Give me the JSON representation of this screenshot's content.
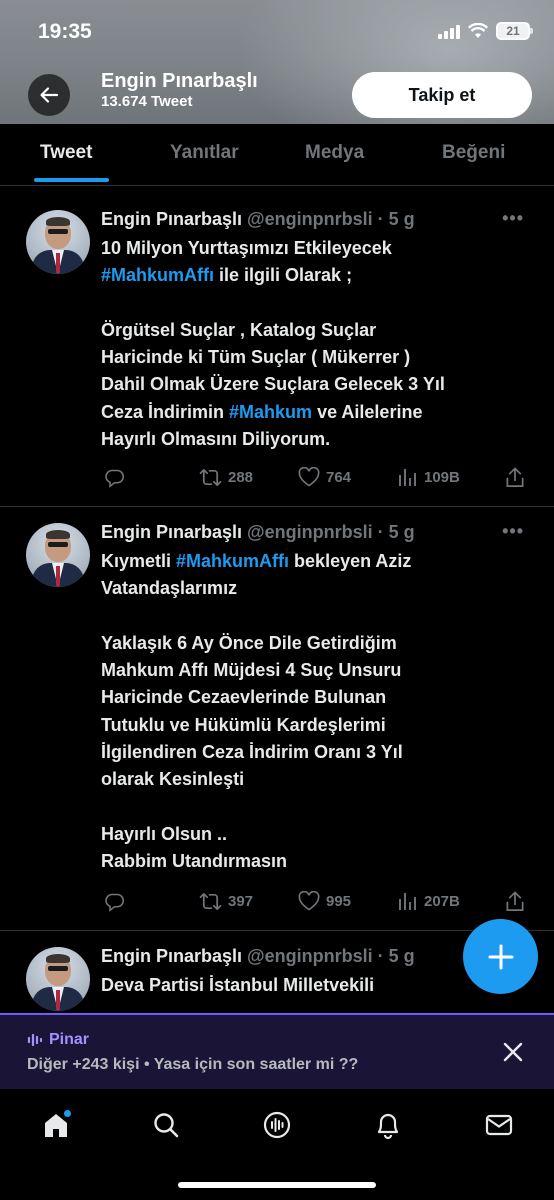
{
  "status_bar": {
    "time": "19:35",
    "battery": "21"
  },
  "header": {
    "name": "Engin Pınarbaşlı",
    "tweet_count": "13.674 Tweet",
    "follow_label": "Takip et"
  },
  "tabs": [
    {
      "label": "Tweet",
      "active": true
    },
    {
      "label": "Yanıtlar",
      "active": false
    },
    {
      "label": "Medya",
      "active": false
    },
    {
      "label": "Beğeni",
      "active": false
    }
  ],
  "tweets": [
    {
      "name": "Engin Pınarbaşlı",
      "handle_time": "@enginpnrbsli · 5 g",
      "body_lines": [
        {
          "parts": [
            "10 Milyon Yurttaşımızı Etkileyecek"
          ]
        },
        {
          "hashtag": "#MahkumAffı",
          "after": " ile ilgili Olarak ;"
        },
        {
          "blank": true
        },
        {
          "parts": [
            "Örgütsel Suçlar , Katalog Suçlar"
          ]
        },
        {
          "parts": [
            "Haricinde ki Tüm Suçlar ( Mükerrer )"
          ]
        },
        {
          "parts": [
            "Dahil Olmak Üzere Suçlara Gelecek  3 Yıl"
          ]
        },
        {
          "before": "Ceza İndirimin ",
          "hashtag": "#Mahkum",
          "after": " ve Ailelerine"
        },
        {
          "parts": [
            "Hayırlı Olmasını Diliyorum."
          ]
        }
      ],
      "retweets": "288",
      "likes": "764",
      "views": "109B"
    },
    {
      "name": "Engin Pınarbaşlı",
      "handle_time": "@enginpnrbsli · 5 g",
      "body_lines": [
        {
          "before": "Kıymetli ",
          "hashtag": "#MahkumAffı",
          "after": " bekleyen Aziz"
        },
        {
          "parts": [
            "Vatandaşlarımız"
          ]
        },
        {
          "blank": true
        },
        {
          "parts": [
            "Yaklaşık 6 Ay Önce Dile Getirdiğim"
          ]
        },
        {
          "parts": [
            "Mahkum Affı Müjdesi 4 Suç Unsuru"
          ]
        },
        {
          "parts": [
            "Haricinde Cezaevlerinde Bulunan"
          ]
        },
        {
          "parts": [
            "Tutuklu ve Hükümlü Kardeşlerimi"
          ]
        },
        {
          "parts": [
            "İlgilendiren Ceza İndirim Oranı 3 Yıl"
          ]
        },
        {
          "parts": [
            "olarak Kesinleşti"
          ]
        },
        {
          "blank": true
        },
        {
          "parts": [
            "Hayırlı Olsun .."
          ]
        },
        {
          "parts": [
            "Rabbim Utandırmasın"
          ]
        }
      ],
      "retweets": "397",
      "likes": "995",
      "views": "207B"
    },
    {
      "name": "Engin Pınarbaşlı",
      "handle_time": "@enginpnrbsli · 5 g",
      "body_lines": [
        {
          "parts": [
            "Deva Partisi İstanbul Milletvekili"
          ]
        }
      ]
    }
  ],
  "spaces": {
    "host": "Pinar",
    "subtitle": "Diğer +243 kişi • Yasa için son saatler mi ??"
  },
  "icons": [
    "back-arrow-icon",
    "more-icon",
    "reply-icon",
    "retweet-icon",
    "like-icon",
    "views-icon",
    "share-icon",
    "compose-icon",
    "audio-wave-icon",
    "close-icon",
    "home-icon",
    "search-icon",
    "spaces-icon",
    "notifications-icon",
    "messages-icon"
  ],
  "colors": {
    "accent": "#1d9bf0",
    "spaces": "#7856ff",
    "muted": "#71767b"
  }
}
